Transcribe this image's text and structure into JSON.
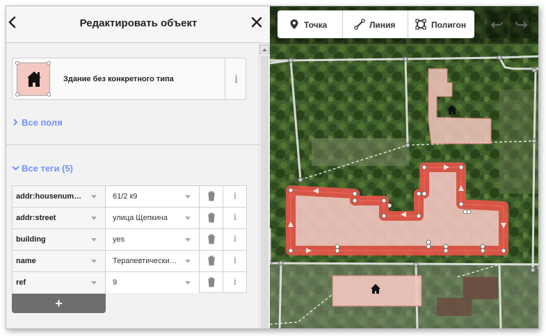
{
  "sidebar": {
    "header": {
      "title": "Редактировать объект"
    },
    "preset": {
      "label": "Здание без конкретного типа",
      "info_glyph": "i"
    },
    "sections": {
      "all_fields": "Все поля",
      "all_tags": "Все теги (5)"
    },
    "tags": [
      {
        "key": "addr:housenum…",
        "value": "61/2 к9"
      },
      {
        "key": "addr:street",
        "value": "улица Щепкина"
      },
      {
        "key": "building",
        "value": "yes"
      },
      {
        "key": "name",
        "value": "Терапевтически…"
      },
      {
        "key": "ref",
        "value": "9"
      }
    ],
    "tag_info_glyph": "i",
    "add_tag_label": "+"
  },
  "toolbar": {
    "point": "Точка",
    "line": "Линия",
    "polygon": "Полигон"
  },
  "colors": {
    "accent": "#7092ff",
    "selected_area": "#e8564a",
    "area_fill": "#f4c7c1",
    "add_button": "#6e6e6e"
  },
  "icons": {
    "back": "chevron-left-icon",
    "close": "close-icon",
    "building": "house-icon",
    "delete": "trash-icon",
    "point": "map-pin-icon",
    "line": "line-icon",
    "polygon": "polygon-icon",
    "undo": "undo-icon",
    "redo": "redo-icon"
  }
}
